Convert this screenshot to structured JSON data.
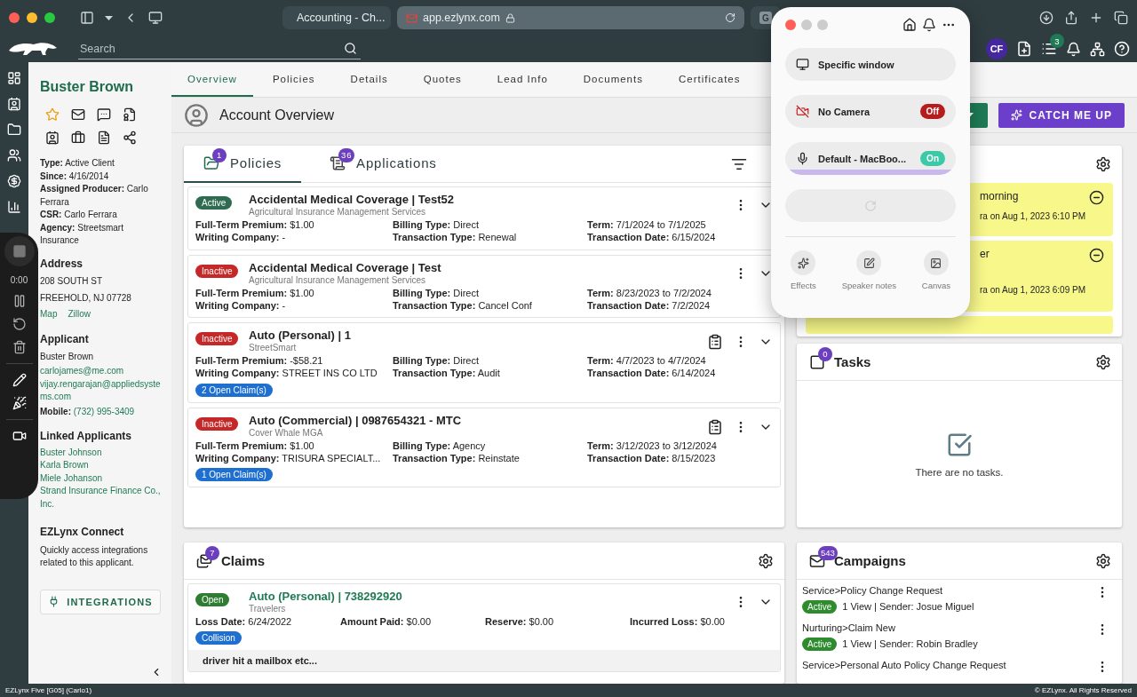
{
  "browser": {
    "tabs": [
      {
        "label": "Accounting - Ch...",
        "selected": false
      },
      {
        "label": "app.ezlynx.com",
        "selected": true
      },
      {
        "favicon": "G",
        "selected": false
      }
    ]
  },
  "app_header": {
    "search": {
      "placeholder": "Search"
    },
    "avatar": "CF",
    "tasks_badge": "3"
  },
  "nav_tabs": [
    {
      "label": "Overview",
      "selected": true
    },
    {
      "label": "Policies",
      "selected": false
    },
    {
      "label": "Details",
      "selected": false
    },
    {
      "label": "Quotes",
      "selected": false
    },
    {
      "label": "Lead Info",
      "selected": false
    },
    {
      "label": "Documents",
      "selected": false
    },
    {
      "label": "Certificates",
      "selected": false
    }
  ],
  "page_title": "Account Overview",
  "catch_me_up": "CATCH ME UP",
  "client": {
    "name": "Buster Brown",
    "facts": [
      "**Type:** Active Client",
      "**Since:** 4/16/2014",
      "**Assigned Producer:** Carlo Ferrara",
      "**CSR:** Carlo Ferrara",
      "**Agency:** Streetsmart Insurance"
    ],
    "address": {
      "title": "Address",
      "lines": [
        "208 SOUTH ST",
        "FREEHOLD, NJ 07728"
      ],
      "links": [
        "Map",
        "Zillow"
      ]
    },
    "applicant": {
      "title": "Applicant",
      "name": "Buster Brown",
      "emails": [
        "carlojames@me.com",
        "vijay.rengarajan@appliedsystems.com"
      ],
      "mobile_label": "Mobile:",
      "mobile": "(732) 995-3409"
    },
    "linked": {
      "title": "Linked Applicants",
      "names": [
        "Buster Johnson",
        "Karla Brown",
        "Miele Johanson",
        "Strand Insurance Finance Co., Inc."
      ]
    },
    "connect": {
      "title": "EZLynx Connect",
      "text": "Quickly access integrations related to this applicant.",
      "button": "INTEGRATIONS"
    }
  },
  "policies_panel": {
    "tabs": [
      {
        "label": "Policies",
        "count": "1",
        "selected": true
      },
      {
        "label": "Applications",
        "count": "36",
        "selected": false
      }
    ],
    "policies": [
      {
        "status": "Active",
        "kind": "active",
        "title": "Accidental Medical Coverage | Test52",
        "carrier": "Agricultural Insurance Management Services",
        "has_clipboard": false,
        "fields": [
          "**Full-Term Premium:** $1.00",
          "**Billing Type:** Direct",
          "**Term:** 7/1/2024 to 7/1/2025",
          "**Writing Company:** -",
          "**Transaction Type:** Renewal",
          "**Transaction Date:** 6/15/2024"
        ]
      },
      {
        "status": "Inactive",
        "kind": "inactive",
        "title": "Accidental Medical Coverage | Test",
        "carrier": "Agricultural Insurance Management Services",
        "has_clipboard": false,
        "fields": [
          "**Full-Term Premium:** $1.00",
          "**Billing Type:** Direct",
          "**Term:** 8/23/2023 to 7/2/2024",
          "**Writing Company:** -",
          "**Transaction Type:** Cancel Conf",
          "**Transaction Date:** 7/2/2024"
        ]
      },
      {
        "status": "Inactive",
        "kind": "inactive",
        "title": "Auto (Personal) | 1",
        "carrier": "StreetSmart",
        "has_clipboard": true,
        "fields": [
          "**Full-Term Premium:** -$58.21",
          "**Billing Type:** Direct",
          "**Term:** 4/7/2023 to 4/7/2024",
          "**Writing Company:** STREET INS CO LTD",
          "**Transaction Type:** Audit",
          "**Transaction Date:** 6/14/2024"
        ],
        "claims": "2 Open Claim(s)"
      },
      {
        "status": "Inactive",
        "kind": "inactive",
        "title": "Auto (Commercial) | 0987654321 - MTC",
        "carrier": "Cover Whale MGA",
        "has_clipboard": true,
        "fields": [
          "**Full-Term Premium:** $1.00",
          "**Billing Type:** Agency",
          "**Term:** 3/12/2023 to 3/12/2024",
          "**Writing Company:** TRISURA SPECIALT...",
          "**Transaction Type:** Reinstate",
          "**Transaction Date:** 8/15/2023"
        ],
        "claims": "1 Open Claim(s)"
      }
    ]
  },
  "claims_panel": {
    "title": "Claims",
    "count": "7",
    "claims": [
      {
        "status": "Open",
        "kind": "open",
        "title": "Auto (Personal) | 738292920",
        "carrier": "Travelers",
        "fields": [
          "**Loss Date:** 6/24/2022",
          "**Amount Paid:** $0.00",
          "**Reserve:** $0.00",
          "**Incurred Loss:** $0.00"
        ],
        "tag": "Collision",
        "note": "driver hit a mailbox etc..."
      }
    ]
  },
  "notes_panel": {
    "notes": [
      {
        "title": "morning",
        "meta": "ra on Aug 1, 2023 6:10 PM"
      },
      {
        "title": "er",
        "meta": "ra on Aug 1, 2023 6:09 PM"
      }
    ]
  },
  "tasks_panel": {
    "title": "Tasks",
    "count": "0",
    "empty": "There are no tasks."
  },
  "campaigns_panel": {
    "title": "Campaigns",
    "count": "543",
    "campaigns": [
      {
        "name": "Service>Policy Change Request",
        "status": "Active",
        "detail": "1 View | Sender: Josue Miguel"
      },
      {
        "name": "Nurturing>Claim New",
        "status": "Active",
        "detail": "1 View | Sender: Robin Bradley"
      },
      {
        "name": "Service>Personal Auto Policy Change Request"
      }
    ]
  },
  "status_bar": {
    "left": "EZLynx Five [G05] (Carlo1)",
    "right": "© EZLynx. All Rights Reserved"
  },
  "recorder": {
    "time": "0:00"
  },
  "recording_popup": {
    "rows": [
      {
        "kind": "source",
        "label": "Specific window"
      },
      {
        "kind": "camera",
        "label": "No Camera",
        "on": false,
        "toggle": "Off"
      },
      {
        "kind": "mic",
        "label": "Default - MacBoo...",
        "on": true,
        "toggle": "On"
      },
      {
        "kind": "loading"
      }
    ],
    "actions": [
      "Effects",
      "Speaker notes",
      "Canvas"
    ]
  }
}
